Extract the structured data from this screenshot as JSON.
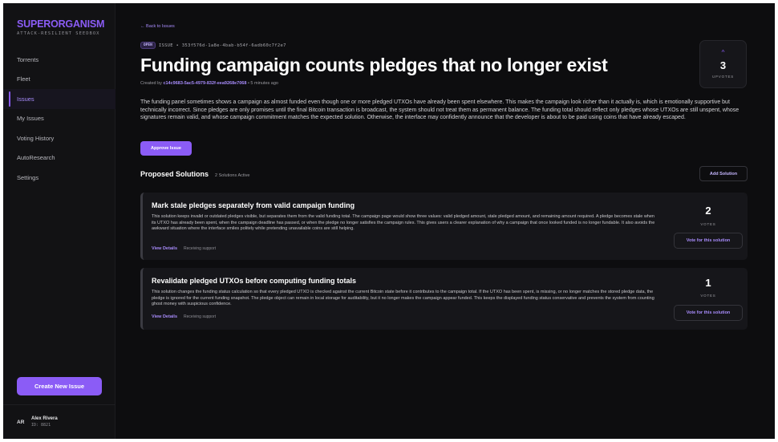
{
  "brand": {
    "name": "SUPERORGANISM",
    "tagline": "ATTACK-RESILIENT SEEDBOX"
  },
  "sidebar": {
    "items": [
      {
        "label": "Torrents"
      },
      {
        "label": "Fleet"
      },
      {
        "label": "Issues"
      },
      {
        "label": "My Issues"
      },
      {
        "label": "Voting History"
      },
      {
        "label": "AutoResearch"
      },
      {
        "label": "Settings"
      }
    ],
    "active": "Issues",
    "create_label": "Create New Issue"
  },
  "user": {
    "initials": "AR",
    "name": "Alex Rivera",
    "id": "ID: 8821"
  },
  "issue": {
    "back_label": "← Back to Issues",
    "status": "OPEN",
    "id_text": "ISSUE • 353f576d-1a8e-4bab-b54f-6adb60c7f2e7",
    "title": "Funding campaign counts pledges that no longer exist",
    "created_prefix": "Created by",
    "creator": "c14c9683-5ac5-4979-832f-eea9268e7068",
    "created_suffix": "• 5 minutes ago",
    "upvote_icon": "chevron-up-icon",
    "upvotes": "3",
    "upvotes_label": "UPVOTES",
    "description": "The funding panel sometimes shows a campaign as almost funded even though one or more pledged UTXOs have already been spent elsewhere. This makes the campaign look richer than it actually is, which is emotionally supportive but technically incorrect. Since pledges are only promises until the final Bitcoin transaction is broadcast, the system should not treat them as permanent balance. The funding total should reflect only pledges whose UTXOs are still unspent, whose signatures remain valid, and whose campaign commitment matches the expected solution. Otherwise, the interface may confidently announce that the developer is about to be paid using coins that have already escaped.",
    "approve_label": "Approve Issue"
  },
  "solutions": {
    "heading": "Proposed Solutions",
    "count_text": "2 Solutions Active",
    "add_label": "Add Solution",
    "items": [
      {
        "title": "Mark stale pledges separately from valid campaign funding",
        "description": "This solution keeps invalid or outdated pledges visible, but separates them from the valid funding total. The campaign page would show three values: valid pledged amount, stale pledged amount, and remaining amount required. A pledge becomes stale when its UTXO has already been spent, when the campaign deadline has passed, or when the pledge no longer satisfies the campaign rules. This gives users a clearer explanation of why a campaign that once looked funded is no longer fundable. It also avoids the awkward situation where the interface smiles politely while pretending unavailable coins are still helping.",
        "view_label": "View Details",
        "support_label": "Receiving support",
        "votes": "2",
        "votes_label": "VOTES",
        "vote_button": "Vote for this solution"
      },
      {
        "title": "Revalidate pledged UTXOs before computing funding totals",
        "description": "This solution changes the funding status calculation so that every pledged UTXO is checked against the current Bitcoin state before it contributes to the campaign total. If the UTXO has been spent, is missing, or no longer matches the stored pledge data, the pledge is ignored for the current funding snapshot. The pledge object can remain in local storage for auditability, but it no longer makes the campaign appear funded. This keeps the displayed funding status conservative and prevents the system from counting ghost money with suspicious confidence.",
        "view_label": "View Details",
        "support_label": "Receiving support",
        "votes": "1",
        "votes_label": "VOTES",
        "vote_button": "Vote for this solution"
      }
    ]
  },
  "colors": {
    "accent": "#8b5cf6",
    "background": "#0d0d0f",
    "sidebar": "#121214",
    "card": "#16161a"
  }
}
